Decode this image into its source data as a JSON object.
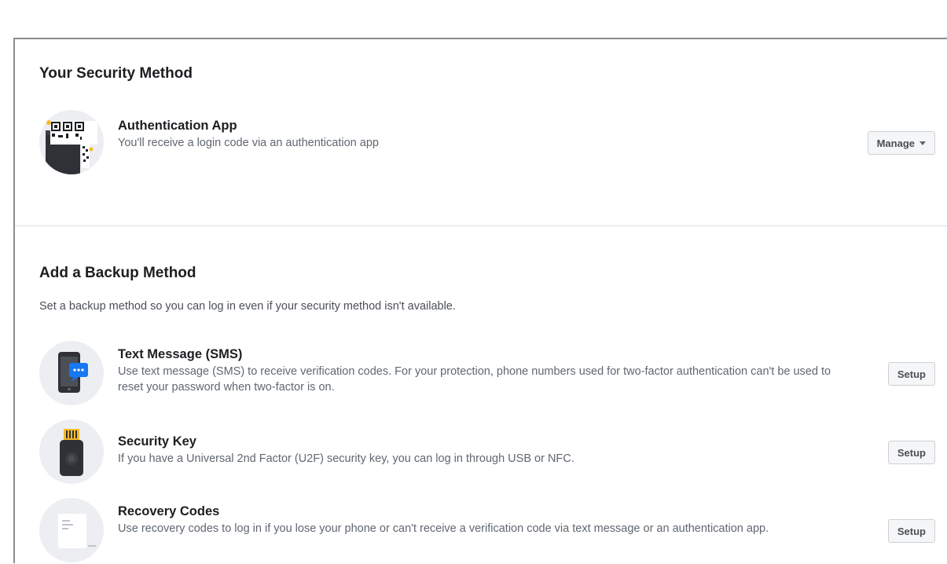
{
  "security": {
    "title": "Your Security Method",
    "method": {
      "name": "Authentication App",
      "description": "You'll receive a login code via an authentication app",
      "icon": "qr-phone-icon",
      "button_label": "Manage"
    }
  },
  "backup": {
    "title": "Add a Backup Method",
    "description": "Set a backup method so you can log in even if your security method isn't available.",
    "methods": [
      {
        "name": "Text Message (SMS)",
        "description": "Use text message (SMS) to receive verification codes. For your protection, phone numbers used for two-factor authentication can't be used to reset your password when two-factor is on.",
        "icon": "sms-phone-icon",
        "button_label": "Setup"
      },
      {
        "name": "Security Key",
        "description": "If you have a Universal 2nd Factor (U2F) security key, you can log in through USB or NFC.",
        "icon": "usb-key-icon",
        "button_label": "Setup"
      },
      {
        "name": "Recovery Codes",
        "description": "Use recovery codes to log in if you lose your phone or can't receive a verification code via text message or an authentication app.",
        "icon": "recovery-codes-icon",
        "button_label": "Setup"
      }
    ]
  },
  "colors": {
    "icon_background": "#eceef1",
    "sms_accent": "#1877f2",
    "key_accent": "#f7b928"
  }
}
